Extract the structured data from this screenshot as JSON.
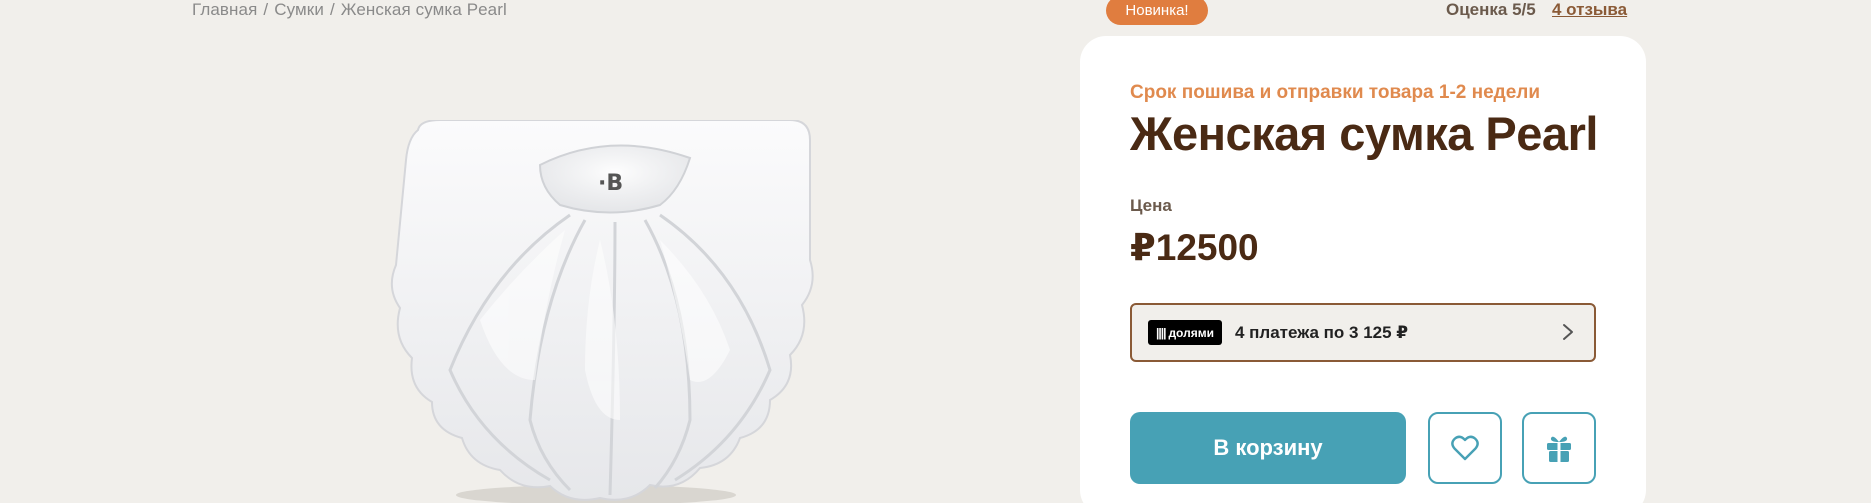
{
  "breadcrumb": {
    "items": [
      "Главная",
      "Сумки",
      "Женская сумка Pearl"
    ],
    "separator": "/"
  },
  "badge": {
    "new_label": "Новинка!"
  },
  "rating": {
    "label": "Оценка 5/5",
    "reviews_link": "4 отзыва"
  },
  "product": {
    "image_alt": "Женская сумка Pearl",
    "lead_time": "Срок пошива и отправки товара 1-2 недели",
    "title": "Женская сумка Pearl",
    "price_label": "Цена",
    "price": "₽12500"
  },
  "dolyami": {
    "logo_bars": "||||",
    "logo_text": "долями",
    "text": "4 платежа по 3 125 ₽"
  },
  "actions": {
    "cart_label": "В корзину"
  },
  "colors": {
    "accent": "#47a1b5",
    "brand_brown": "#4a2a14",
    "badge_orange": "#e07d3f",
    "lead_time_orange": "#e08a4e",
    "background": "#f1efeb"
  },
  "icons": {
    "chevron": "chevron-right-icon",
    "favorite": "heart-icon",
    "gift": "gift-icon"
  }
}
